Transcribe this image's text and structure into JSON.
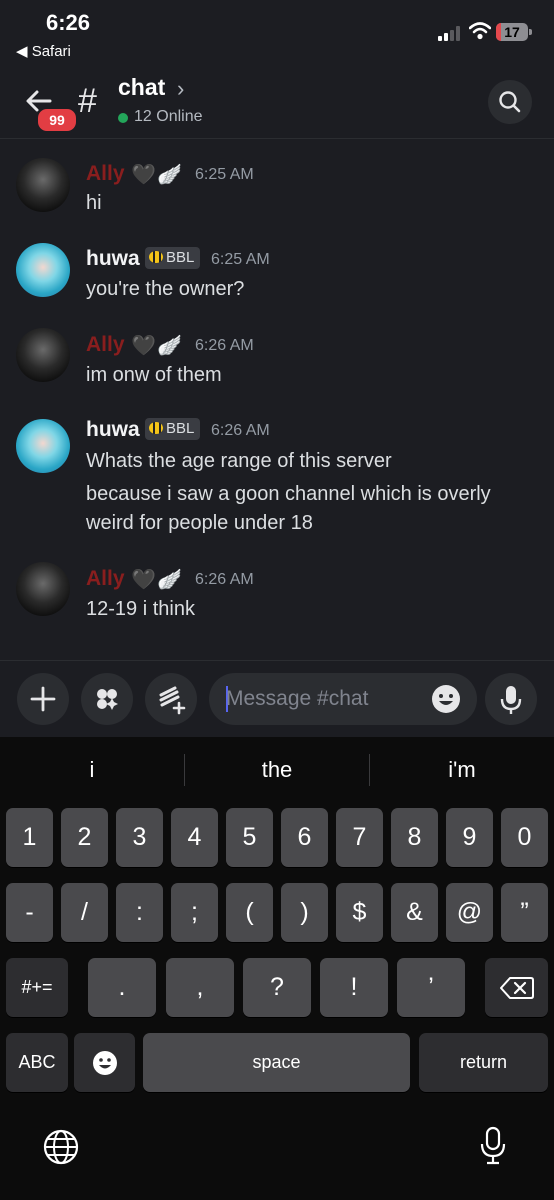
{
  "status_bar": {
    "time": "6:26",
    "back_app": "◀ Safari",
    "battery": "17",
    "battery_level_percent": 17
  },
  "header": {
    "badge": "99",
    "channel_name": "chat",
    "online": "12 Online"
  },
  "messages": [
    {
      "author": "Ally",
      "time": "6:25 AM",
      "lines": [
        "hi"
      ]
    },
    {
      "author": "huwa",
      "tag": "BBL",
      "time": "6:25 AM",
      "lines": [
        "you're the owner?"
      ]
    },
    {
      "author": "Ally",
      "time": "6:26 AM",
      "lines": [
        "im onw of them"
      ]
    },
    {
      "author": "huwa",
      "tag": "BBL",
      "time": "6:26 AM",
      "lines": [
        "Whats the age range of this server",
        "because i saw a goon channel which is overly",
        "weird for people under 18"
      ]
    },
    {
      "author": "Ally",
      "time": "6:26 AM",
      "lines": [
        "12-19 i think"
      ]
    }
  ],
  "composer": {
    "placeholder": "Message #chat"
  },
  "keyboard": {
    "suggestions": [
      "i",
      "the",
      "i'm"
    ],
    "row1": [
      "1",
      "2",
      "3",
      "4",
      "5",
      "6",
      "7",
      "8",
      "9",
      "0"
    ],
    "row2": [
      "-",
      "/",
      ":",
      ";",
      "(",
      ")",
      "$",
      "&",
      "@",
      "”"
    ],
    "row3": [
      ".",
      ",",
      "?",
      "!",
      "’"
    ],
    "mode_key": "#+=",
    "abc_key": "ABC",
    "space": "space",
    "return": "return"
  },
  "colors": {
    "ally_name": "#8a1e1e",
    "online": "#23a55a",
    "badge": "#e23d43",
    "accent": "#5865f2"
  }
}
